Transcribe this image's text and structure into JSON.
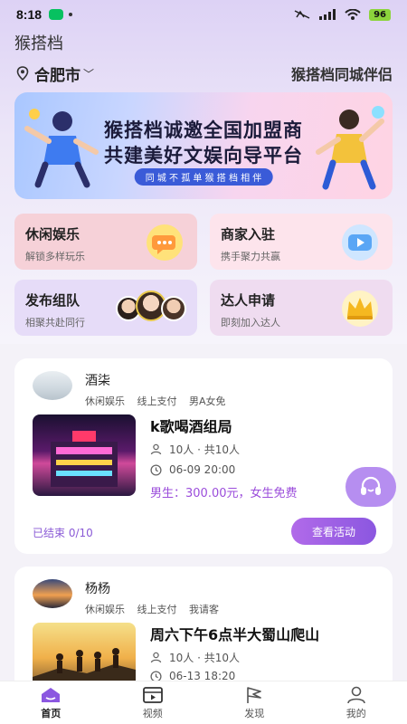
{
  "status": {
    "time": "8:18",
    "battery": "96"
  },
  "app": {
    "title": "猴搭档"
  },
  "location": {
    "city": "合肥市",
    "slogan": "猴搭档同城伴侣"
  },
  "banner": {
    "line1": "猴搭档诚邀全国加盟商",
    "line2": "共建美好文娱向导平台",
    "tag": "同 城 不 孤 单    猴 搭 档 相 伴"
  },
  "tiles": [
    {
      "title": "休闲娱乐",
      "sub": "解锁多样玩乐"
    },
    {
      "title": "商家入驻",
      "sub": "携手聚力共赢"
    },
    {
      "title": "发布组队",
      "sub": "相聚共赴同行"
    },
    {
      "title": "达人申请",
      "sub": "即刻加入达人"
    }
  ],
  "cards": [
    {
      "user": "酒柒",
      "tags": [
        "休闲娱乐",
        "线上支付",
        "男A女免"
      ],
      "title": "k歌喝酒组局",
      "people": "10人 · 共10人",
      "time": "06-09 20:00",
      "price": "男生：300.00元，女生免费",
      "status": "已结束 0/10",
      "button": "查看活动"
    },
    {
      "user": "杨杨",
      "tags": [
        "休闲娱乐",
        "线上支付",
        "我请客"
      ],
      "title": "周六下午6点半大蜀山爬山",
      "people": "10人 · 共10人",
      "time": "06-13 18:20"
    }
  ],
  "tabs": [
    {
      "label": "首页"
    },
    {
      "label": "视频"
    },
    {
      "label": "发现"
    },
    {
      "label": "我的"
    }
  ],
  "colors": {
    "accent": "#9b5de5",
    "price": "#9b4ddb"
  }
}
